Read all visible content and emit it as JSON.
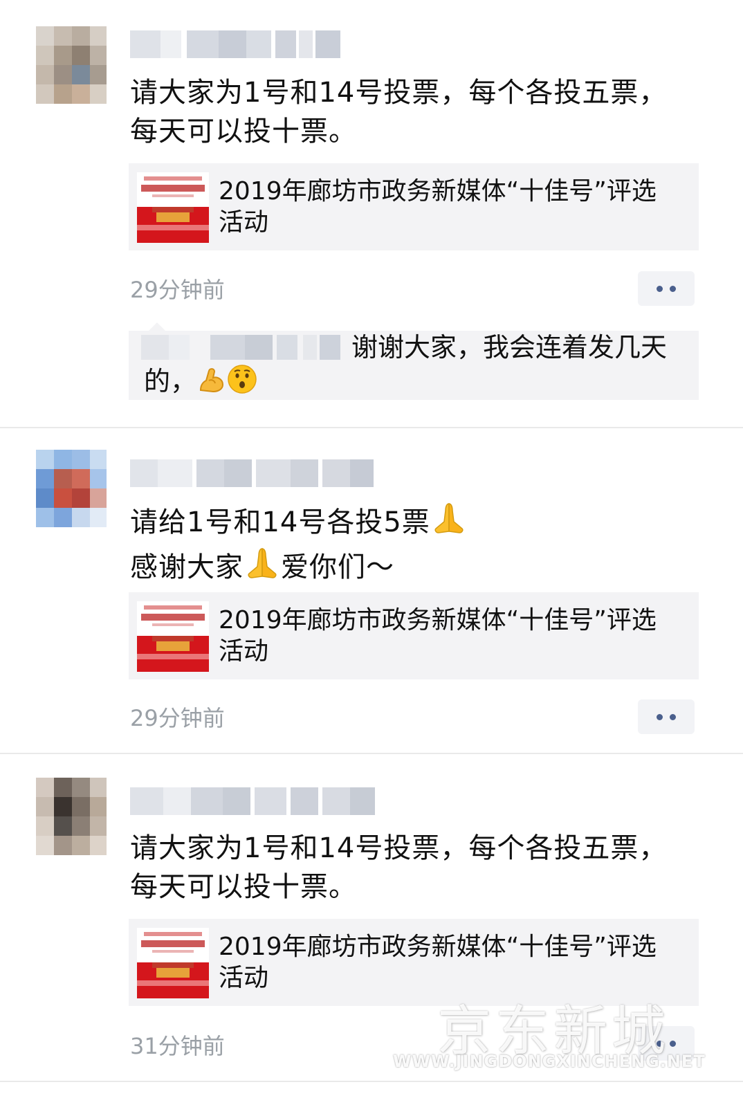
{
  "posts": [
    {
      "text_lines": [
        "请大家为1号和14号投票，每个各投五票，",
        "每天可以投十票。"
      ],
      "link_title_lines": [
        "2019年廊坊市政务新媒体“十佳号”评选",
        "活动"
      ],
      "time": "29分钟前",
      "reply": {
        "text_line1": "谢谢大家，我会连着发几天",
        "text_line2": "的，",
        "emojis": [
          "flexed-biceps",
          "hushed-face"
        ]
      }
    },
    {
      "text_line1": "请给1号和14号各投5票",
      "text_line2_a": "感谢大家",
      "text_line2_b": "爱你们～",
      "emojis": [
        "folded-hands",
        "folded-hands"
      ],
      "link_title_lines": [
        "2019年廊坊市政务新媒体“十佳号”评选",
        "活动"
      ],
      "time": "29分钟前"
    },
    {
      "text_lines": [
        "请大家为1号和14号投票，每个各投五票，",
        "每天可以投十票。"
      ],
      "link_title_lines": [
        "2019年廊坊市政务新媒体“十佳号”评选",
        "活动"
      ],
      "time": "31分钟前"
    }
  ],
  "watermark": {
    "title": "京东新城",
    "url": "WWW.JINGDONGXINCHENG.NET"
  },
  "colors": {
    "time": "#9aa0a6",
    "card_bg": "#f3f3f5",
    "more_dots": "#4a5f8c"
  }
}
